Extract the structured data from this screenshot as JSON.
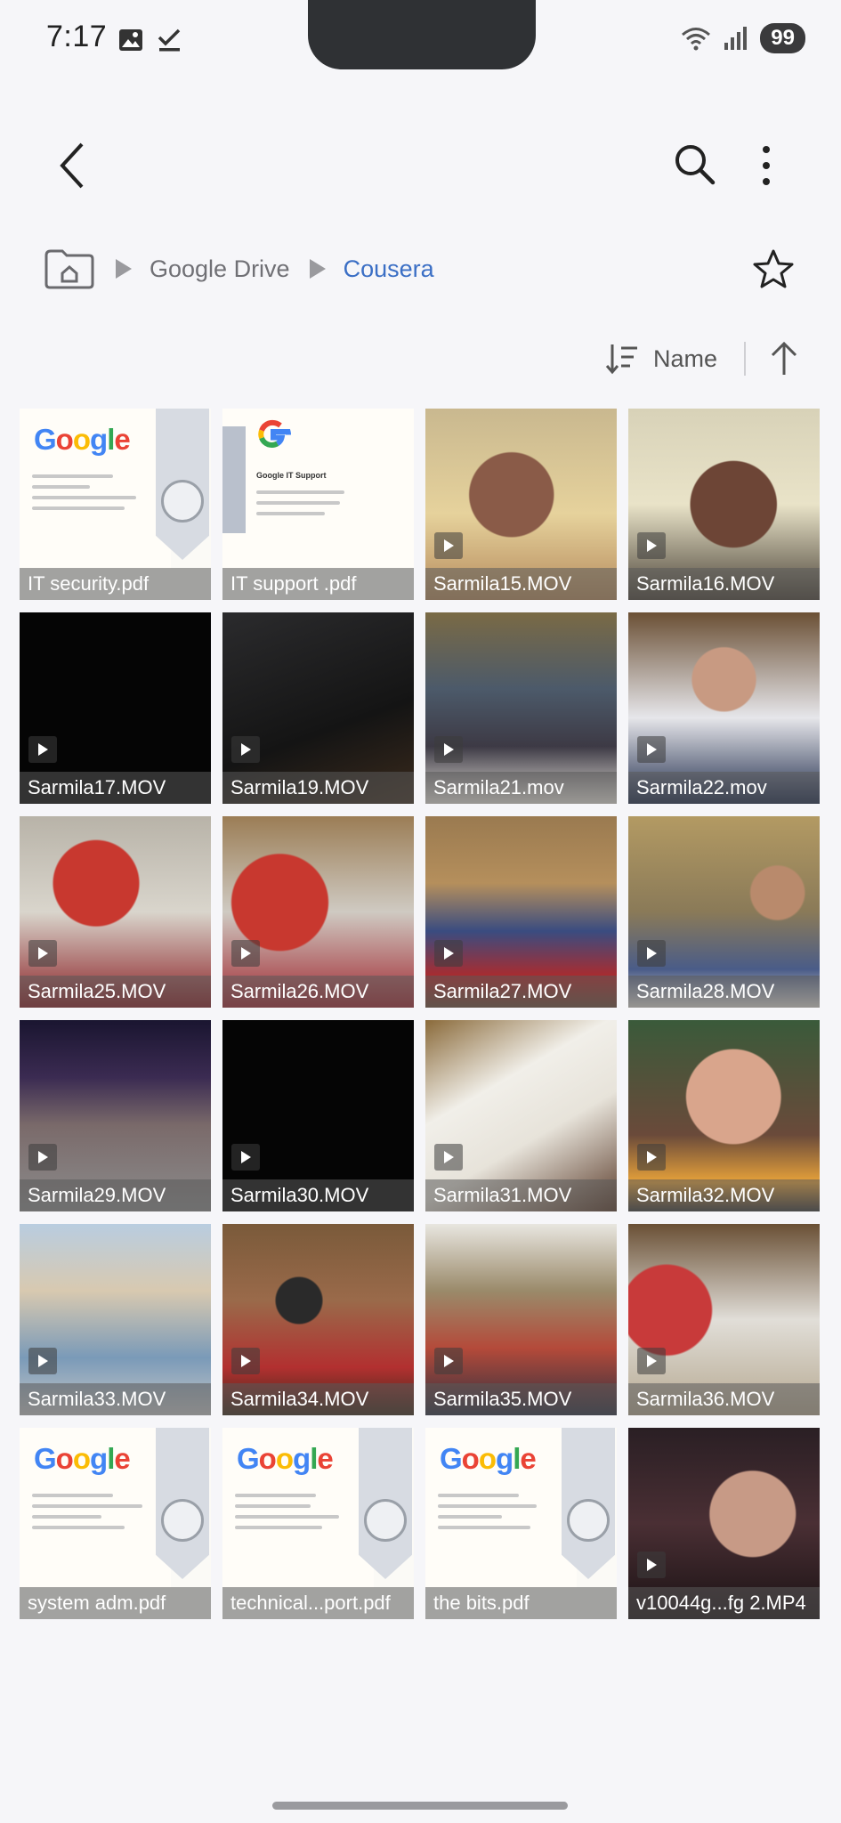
{
  "status_bar": {
    "time": "7:17",
    "battery": "99",
    "icons": [
      "image-icon",
      "check-icon",
      "wifi-icon",
      "signal-icon",
      "battery-icon"
    ]
  },
  "app_bar": {
    "icons": [
      "back-arrow-icon",
      "search-icon",
      "more-vert-icon"
    ]
  },
  "breadcrumb": {
    "home_icon": "home-folder-icon",
    "items": [
      "Google Drive",
      "Cousera"
    ],
    "favorite_icon": "star-icon"
  },
  "sort": {
    "label": "Name",
    "icons": [
      "sort-icon",
      "arrow-up-icon"
    ]
  },
  "files": [
    {
      "name": "IT security.pdf"
    },
    {
      "name": "IT support .pdf"
    },
    {
      "name": "Sarmila15.MOV"
    },
    {
      "name": "Sarmila16.MOV"
    },
    {
      "name": "Sarmila17.MOV"
    },
    {
      "name": "Sarmila19.MOV"
    },
    {
      "name": "Sarmila21.mov"
    },
    {
      "name": "Sarmila22.mov"
    },
    {
      "name": "Sarmila25.MOV"
    },
    {
      "name": "Sarmila26.MOV"
    },
    {
      "name": "Sarmila27.MOV"
    },
    {
      "name": "Sarmila28.MOV"
    },
    {
      "name": "Sarmila29.MOV"
    },
    {
      "name": "Sarmila30.MOV"
    },
    {
      "name": "Sarmila31.MOV"
    },
    {
      "name": "Sarmila32.MOV"
    },
    {
      "name": "Sarmila33.MOV"
    },
    {
      "name": "Sarmila34.MOV"
    },
    {
      "name": "Sarmila35.MOV"
    },
    {
      "name": "Sarmila36.MOV"
    },
    {
      "name": "system adm.pdf"
    },
    {
      "name": "technical...port.pdf"
    },
    {
      "name": "the bits.pdf"
    },
    {
      "name": "v10044g...fg 2.MP4"
    }
  ],
  "thumbnail_text": {
    "google_wordmark": "Google",
    "support_title": "Google IT Support"
  },
  "colors": {
    "background": "#f6f6f9",
    "accent": "#3b6fc5",
    "google_blue": "#4285F4",
    "google_red": "#EA4335",
    "google_yellow": "#FBBC05",
    "google_green": "#34A853"
  }
}
